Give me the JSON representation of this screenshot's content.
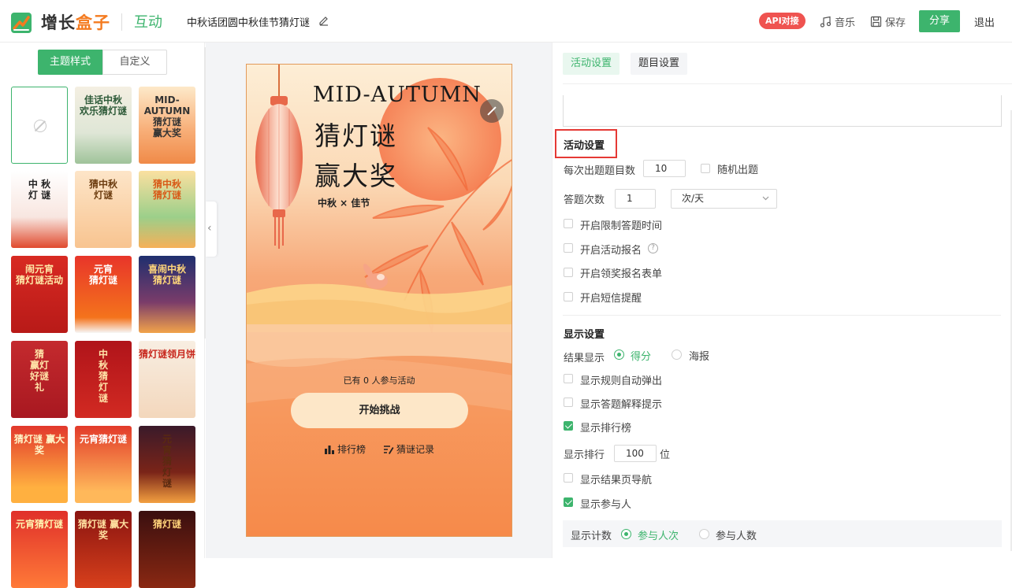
{
  "topbar": {
    "logo_text_a": "增长",
    "logo_text_b": "盒子",
    "module": "互动",
    "activity_title": "中秋话团圆中秋佳节猜灯谜",
    "api_badge": "API对接",
    "music": "音乐",
    "save": "保存",
    "share": "分享",
    "exit": "退出",
    "brand_color": "#3db46d"
  },
  "theme_panel": {
    "tabs": [
      "主题样式",
      "自定义"
    ],
    "thumbnails": [
      {
        "name": "none"
      },
      {
        "name": "theme-birds",
        "text": "佳话中秋\n欢乐猜灯谜",
        "bg": "linear-gradient(180deg,#f4efe2,#dfe6d6 60%,#9fc39a)",
        "color": "#2d5a38"
      },
      {
        "name": "theme-mid-autumn-orange",
        "text": "MID-AUTUMN\n猜灯谜\n赢大奖",
        "bg": "linear-gradient(180deg,#fde9c9,#f8b07a 55%,#f08a48)",
        "color": "#333"
      },
      {
        "name": "theme-lantern-red",
        "text": "中 秋\n灯 谜",
        "bg": "linear-gradient(180deg,#fff,#f8e6e0 60%,#e04a2e)",
        "color": "#222"
      },
      {
        "name": "theme-moon-orange",
        "text": "猜中秋\n灯谜",
        "bg": "linear-gradient(180deg,#fde5c8,#f8c490)",
        "color": "#6d3d10"
      },
      {
        "name": "theme-rabbit-green",
        "text": "猜中秋\n猜灯谜",
        "bg": "linear-gradient(180deg,#fbe0a0,#9ccf8a 60%,#f6b058)",
        "color": "#d85a18"
      },
      {
        "name": "theme-lantern-festival",
        "text": "闹元宵\n猜灯谜活动",
        "bg": "linear-gradient(180deg,#d82a22,#b81a18)",
        "color": "#ffe9a8"
      },
      {
        "name": "theme-yuanxiao",
        "text": "元宵\n猜灯谜",
        "bg": "linear-gradient(180deg,#e8352a,#f4731c 80%,#f7f7f7)",
        "color": "#fff"
      },
      {
        "name": "theme-night-lanterns",
        "text": "喜闹中秋\n猜灯谜",
        "bg": "linear-gradient(180deg,#1f2f6e,#7a3c6a 60%,#f2a34a)",
        "color": "#ffd77a"
      },
      {
        "name": "theme-red-prize",
        "text": "猜\n赢灯\n好谜\n礼",
        "bg": "linear-gradient(180deg,#c42a2e,#a81820)",
        "color": "#ffe3a8"
      },
      {
        "name": "theme-red-mid",
        "text": "中\n秋\n猜\n灯\n谜",
        "bg": "linear-gradient(180deg,#b0141a,#d22a22)",
        "color": "#ffe3a8"
      },
      {
        "name": "theme-rabbit-mooncake",
        "text": "猜灯谜领月饼",
        "bg": "linear-gradient(180deg,#f8eee2,#f3d7bc)",
        "color": "#c8281e"
      },
      {
        "name": "theme-prize-red",
        "text": "猜灯谜 赢大奖",
        "bg": "linear-gradient(180deg,#e2382c,#ffb040 80%)",
        "color": "#fff6c8"
      },
      {
        "name": "theme-rabbits-red",
        "text": "元宵猜灯谜",
        "bg": "linear-gradient(180deg,#e23a2a,#ffb85a 85%)",
        "color": "#fff"
      },
      {
        "name": "theme-lantern-dark",
        "text": "元\n宵\n猜\n灯\n谜",
        "bg": "linear-gradient(180deg,#3a1a2a,#7a2418 60%,#f3a040)",
        "color": "#5a2a10"
      },
      {
        "name": "theme-yuanxiao-2",
        "text": "元宵猜灯谜",
        "bg": "linear-gradient(180deg,#e0302a,#ff7a38)",
        "color": "#fff3b0"
      },
      {
        "name": "theme-prize-2",
        "text": "猜灯谜 赢大奖",
        "bg": "linear-gradient(180deg,#8a1410,#d8401c)",
        "color": "#ffe0a0"
      },
      {
        "name": "theme-dark-gold",
        "text": "猜灯谜",
        "bg": "linear-gradient(180deg,#3a0f0f,#8a2812)",
        "color": "#ffd27a"
      }
    ]
  },
  "preview": {
    "title_en": "MID-AUTUMN",
    "line1": "猜灯谜",
    "line2": "赢大奖",
    "subtitle": "中秋 × 佳节",
    "participants_text": "已有 0 人参与活动",
    "start_button": "开始挑战",
    "ranking": "排行榜",
    "records": "猜谜记录"
  },
  "settings": {
    "tabs": [
      "活动设置",
      "题目设置"
    ],
    "section_activity": "活动设置",
    "questions_per_round_label": "每次出题题目数",
    "questions_per_round_value": "10",
    "random_label": "随机出题",
    "attempts_label": "答题次数",
    "attempts_value": "1",
    "attempts_unit": "次/天",
    "limit_time": "开启限制答题时间",
    "registration": "开启活动报名",
    "prize_form": "开启领奖报名表单",
    "sms": "开启短信提醒",
    "section_display": "显示设置",
    "result_label": "结果显示",
    "result_score": "得分",
    "result_poster": "海报",
    "rules_popup": "显示规则自动弹出",
    "answer_hint": "显示答题解释提示",
    "show_ranking": "显示排行榜",
    "ranking_label": "显示排行",
    "ranking_value": "100",
    "ranking_unit": "位",
    "result_nav": "显示结果页导航",
    "show_participants": "显示参与人",
    "count_label": "显示计数",
    "count_times": "参与人次",
    "count_people": "参与人数"
  }
}
